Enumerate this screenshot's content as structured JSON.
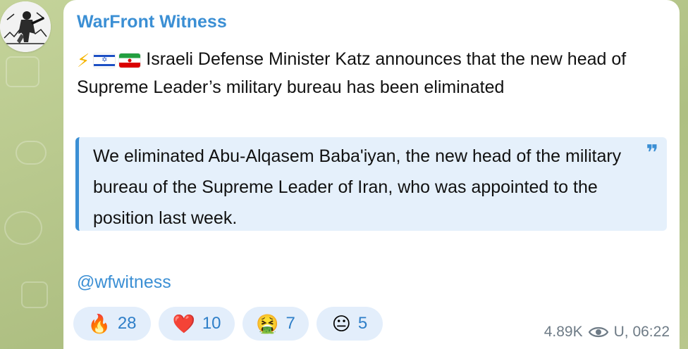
{
  "channel": {
    "name": "WarFront Witness",
    "avatar_icon": "soldier-avatar-icon"
  },
  "message": {
    "lead_icons": [
      "lightning-icon",
      "israel-flag-icon",
      "iran-flag-icon"
    ],
    "headline": "Israeli Defense Minister Katz announces that the new head of Supreme Leader’s military bureau has been eliminated",
    "quote": "We eliminated Abu-Alqasem Baba'iyan, the new head of the military bureau of the Supreme Leader of Iran, who was appointed to the position last week.",
    "quote_mark": "❞",
    "mention": "@wfwitness"
  },
  "reactions": [
    {
      "emoji": "🔥",
      "icon": "fire-icon",
      "count": "28"
    },
    {
      "emoji": "❤️",
      "icon": "heart-icon",
      "count": "10"
    },
    {
      "emoji": "🤮",
      "icon": "vomit-face-icon",
      "count": "7"
    },
    {
      "emoji": "😐",
      "icon": "neutral-face-icon",
      "count": "5"
    }
  ],
  "meta": {
    "views": "4.89K",
    "time": "U, 06:22"
  },
  "colors": {
    "accent": "#3b8fd4",
    "quote_bg": "#e5f0fb",
    "reaction_bg": "#e3eefb",
    "wallpaper": "#b9c98f"
  }
}
